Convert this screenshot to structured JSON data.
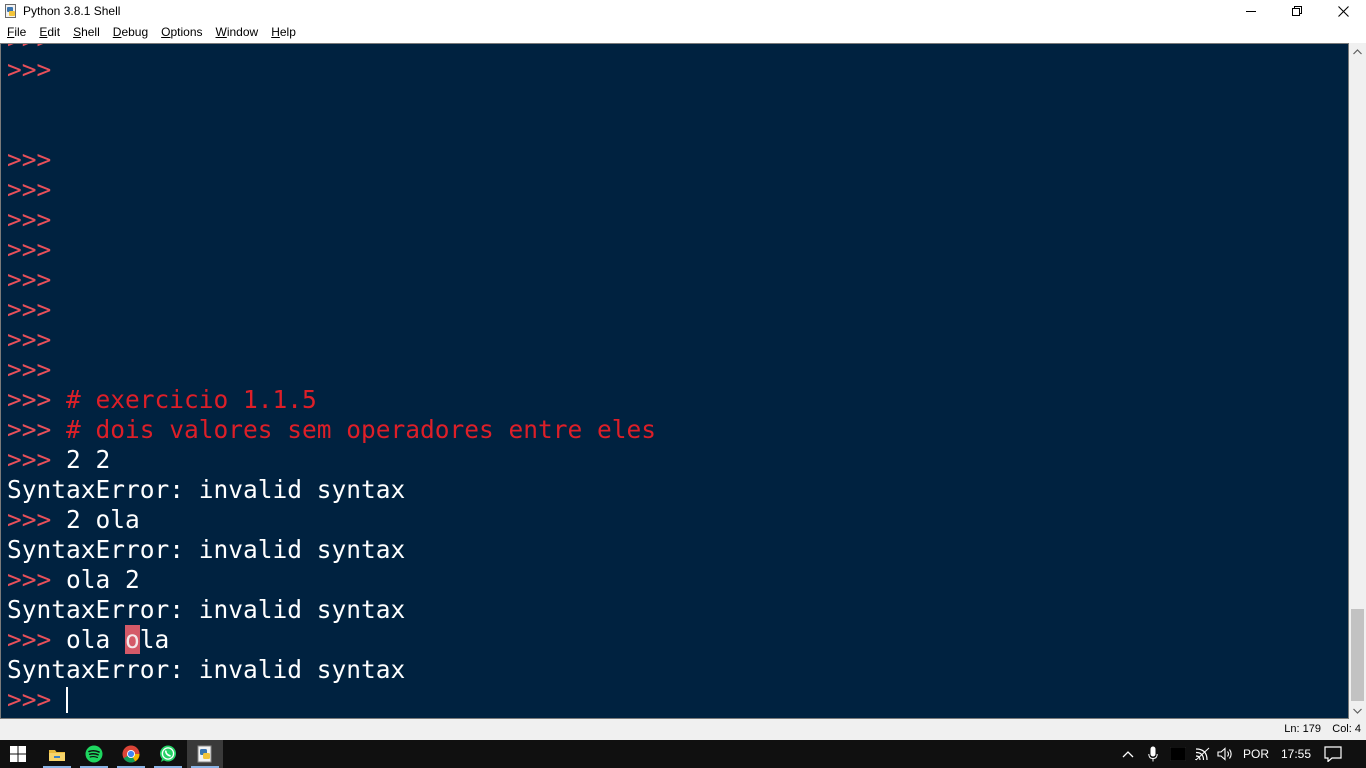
{
  "window": {
    "title": "Python 3.8.1 Shell"
  },
  "menu": [
    {
      "label": "File",
      "accel": "F"
    },
    {
      "label": "Edit",
      "accel": "E"
    },
    {
      "label": "Shell",
      "accel": "S"
    },
    {
      "label": "Debug",
      "accel": "D"
    },
    {
      "label": "Options",
      "accel": "O"
    },
    {
      "label": "Window",
      "accel": "W"
    },
    {
      "label": "Help",
      "accel": "H"
    }
  ],
  "shell": {
    "prompt": ">>>",
    "lines": [
      {
        "kind": "prompt",
        "text": ""
      },
      {
        "kind": "prompt",
        "text": ""
      },
      {
        "kind": "blank",
        "text": ""
      },
      {
        "kind": "blank",
        "text": ""
      },
      {
        "kind": "prompt",
        "text": ""
      },
      {
        "kind": "prompt",
        "text": ""
      },
      {
        "kind": "prompt",
        "text": ""
      },
      {
        "kind": "prompt",
        "text": ""
      },
      {
        "kind": "prompt",
        "text": ""
      },
      {
        "kind": "prompt",
        "text": ""
      },
      {
        "kind": "prompt",
        "text": ""
      },
      {
        "kind": "prompt",
        "text": ""
      },
      {
        "kind": "comment",
        "text": "# exercicio 1.1.5"
      },
      {
        "kind": "comment",
        "text": "# dois valores sem operadores entre eles"
      },
      {
        "kind": "code",
        "text": "2 2"
      },
      {
        "kind": "error",
        "text": "SyntaxError: invalid syntax"
      },
      {
        "kind": "code",
        "text": "2 ola"
      },
      {
        "kind": "error",
        "text": "SyntaxError: invalid syntax"
      },
      {
        "kind": "code",
        "text": "ola 2"
      },
      {
        "kind": "error",
        "text": "SyntaxError: invalid syntax"
      },
      {
        "kind": "code-hl",
        "before": "ola ",
        "hl": "o",
        "after": "la"
      },
      {
        "kind": "error",
        "text": "SyntaxError: invalid syntax"
      },
      {
        "kind": "cursor",
        "text": ""
      }
    ]
  },
  "status": {
    "ln": "Ln: 179",
    "col": "Col: 4"
  },
  "taskbar": {
    "apps": [
      {
        "name": "start-button",
        "icon": "windows-logo-icon"
      },
      {
        "name": "taskbar-file-explorer",
        "icon": "folder-icon"
      },
      {
        "name": "taskbar-spotify",
        "icon": "spotify-icon"
      },
      {
        "name": "taskbar-chrome",
        "icon": "chrome-icon"
      },
      {
        "name": "taskbar-whatsapp",
        "icon": "whatsapp-icon"
      },
      {
        "name": "taskbar-python-idle",
        "icon": "python-idle-icon"
      }
    ],
    "language": "POR",
    "clock": "17:55"
  },
  "colors": {
    "shell_bg": "#002240",
    "prompt": "#e8505a",
    "comment": "#dd1f28",
    "code": "#ffffff",
    "highlight": "#d45a68"
  }
}
